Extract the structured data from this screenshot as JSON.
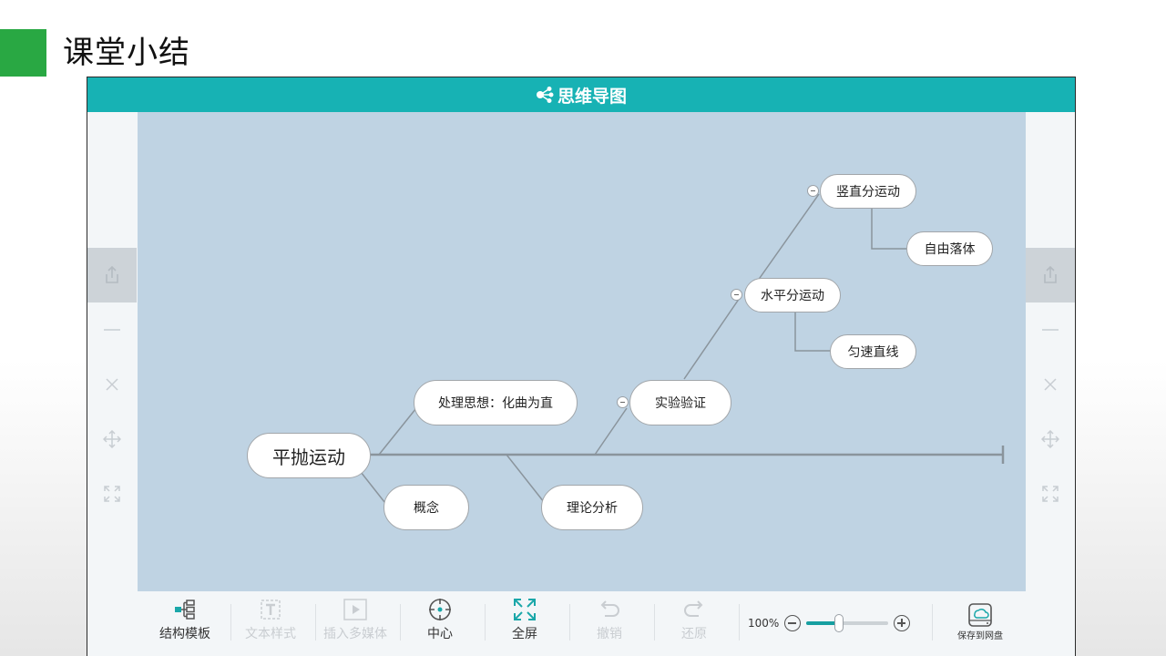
{
  "slide": {
    "title": "课堂小结"
  },
  "app": {
    "title": "思维导图"
  },
  "colors": {
    "accent": "#29a843",
    "titlebar": "#17b2b4",
    "canvas": "#bfd3e3"
  },
  "side_panel": {
    "icons": [
      "share-icon",
      "minus-icon",
      "close-icon",
      "move-icon",
      "expand-icon"
    ]
  },
  "mindmap": {
    "root": "平抛运动",
    "nodes": {
      "processing": "处理思想：化曲为直",
      "concept": "概念",
      "theory": "理论分析",
      "experiment": "实验验证",
      "horizontal": "水平分运动",
      "uniform": "匀速直线",
      "vertical": "竖直分运动",
      "freefall": "自由落体"
    }
  },
  "toolbar": {
    "structure": "结构模板",
    "text_style": "文本样式",
    "insert_media": "插入多媒体",
    "center": "中心",
    "fullscreen": "全屏",
    "undo": "撤销",
    "redo": "还原",
    "zoom_level": "100%",
    "zoom_fraction": 0.4,
    "save": "保存到网盘"
  }
}
